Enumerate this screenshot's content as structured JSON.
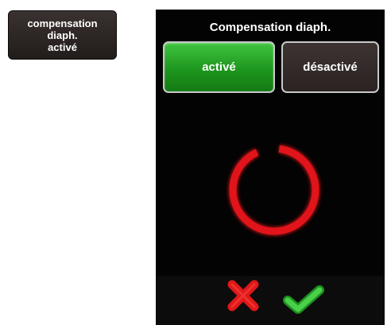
{
  "status_tile": {
    "lines": [
      "compensation",
      "diaph.",
      "activé"
    ]
  },
  "screen": {
    "title": "Compensation diaph.",
    "options": {
      "active_label": "activé",
      "inactive_label": "désactivé",
      "selected": "activé"
    },
    "actions": {
      "cancel_icon": "red-x-icon",
      "confirm_icon": "green-check-icon"
    },
    "loading_indicator": "red-ring-spinner"
  },
  "colors": {
    "selected_button": "#22a022",
    "unselected_button": "#342c2b",
    "spinner": "#e0141a",
    "cancel": "#e01818",
    "confirm": "#2fb52f"
  }
}
